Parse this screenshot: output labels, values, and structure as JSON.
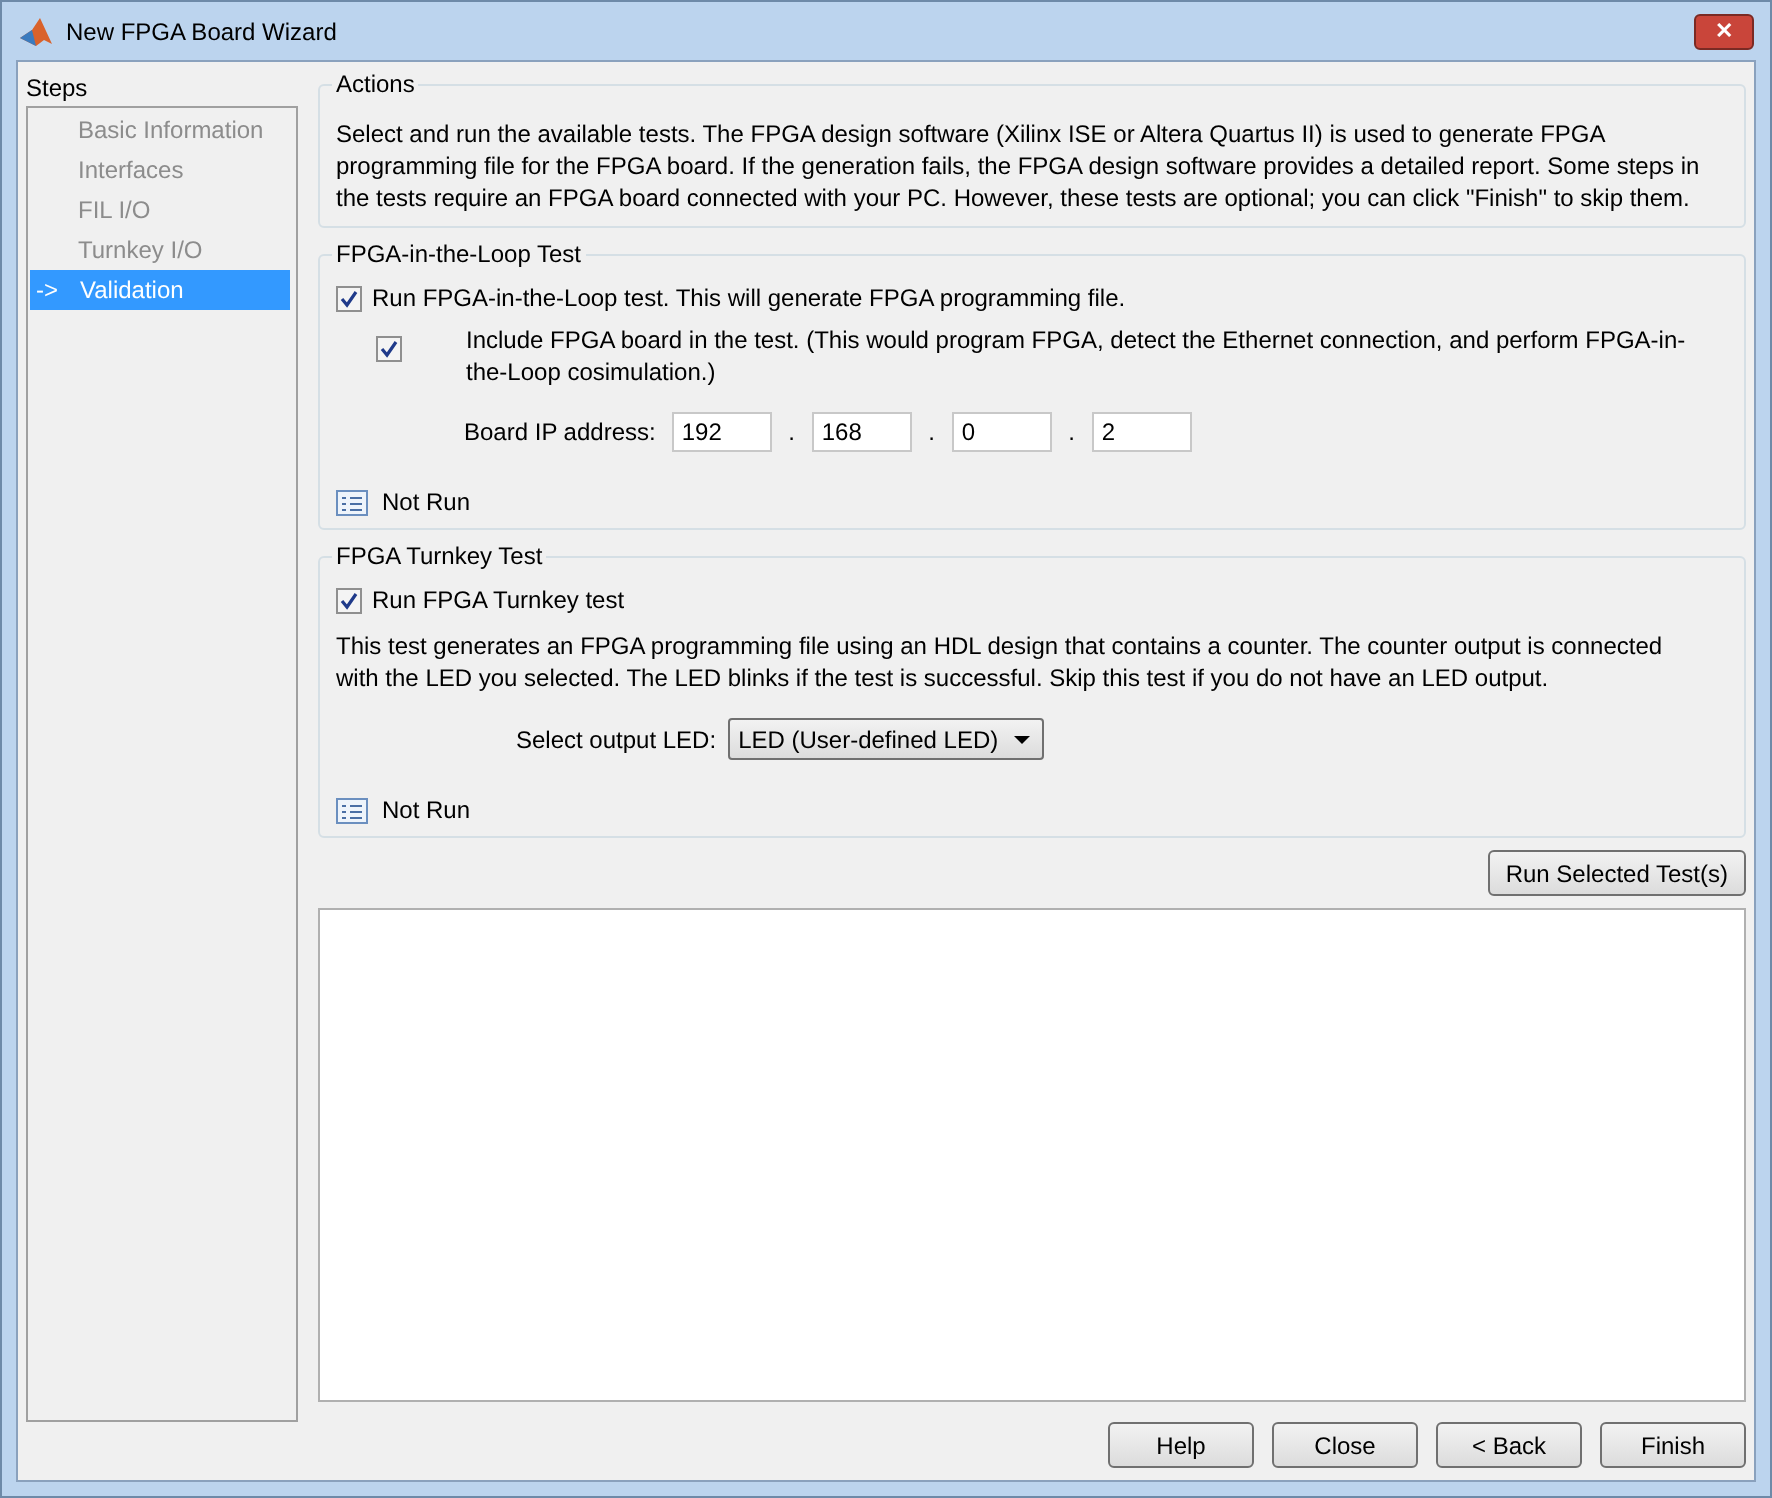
{
  "window": {
    "title": "New FPGA Board Wizard",
    "close_label": "✕"
  },
  "steps": {
    "title": "Steps",
    "marker": "->",
    "items": [
      {
        "label": "Basic Information",
        "selected": false
      },
      {
        "label": "Interfaces",
        "selected": false
      },
      {
        "label": "FIL I/O",
        "selected": false
      },
      {
        "label": "Turnkey I/O",
        "selected": false
      },
      {
        "label": "Validation",
        "selected": true
      }
    ]
  },
  "actions": {
    "title": "Actions",
    "text": "Select and run the available tests. The FPGA design software (Xilinx ISE or Altera Quartus II) is used to generate FPGA programming file for the FPGA board. If the generation fails, the FPGA design software provides a detailed report. Some steps in the tests require an FPGA board connected with your PC. However, these tests are optional; you can click \"Finish\" to skip them."
  },
  "fil_test": {
    "title": "FPGA-in-the-Loop Test",
    "run_checkbox": {
      "label": "Run FPGA-in-the-Loop test. This will generate FPGA programming file.",
      "checked": true
    },
    "include_checkbox": {
      "label": "Include FPGA board in the test. (This would program FPGA, detect the Ethernet connection, and perform FPGA-in-the-Loop cosimulation.)",
      "checked": true
    },
    "ip_label": "Board IP address:",
    "ip_fields": [
      "192",
      "168",
      "0",
      "2"
    ],
    "ip_separator": ".",
    "status": "Not Run"
  },
  "turnkey_test": {
    "title": "FPGA Turnkey Test",
    "run_checkbox": {
      "label": "Run FPGA Turnkey test",
      "checked": true
    },
    "description": "This test generates an FPGA programming file using an HDL design that contains a counter. The counter output is connected with the LED you selected. The LED blinks if the test is successful. Skip this test if you do not have an LED output.",
    "led_label": "Select output LED:",
    "led_value": "LED (User-defined LED)",
    "status": "Not Run"
  },
  "run_button": "Run Selected Test(s)",
  "buttons": [
    "Help",
    "Close",
    "< Back",
    "Finish"
  ]
}
